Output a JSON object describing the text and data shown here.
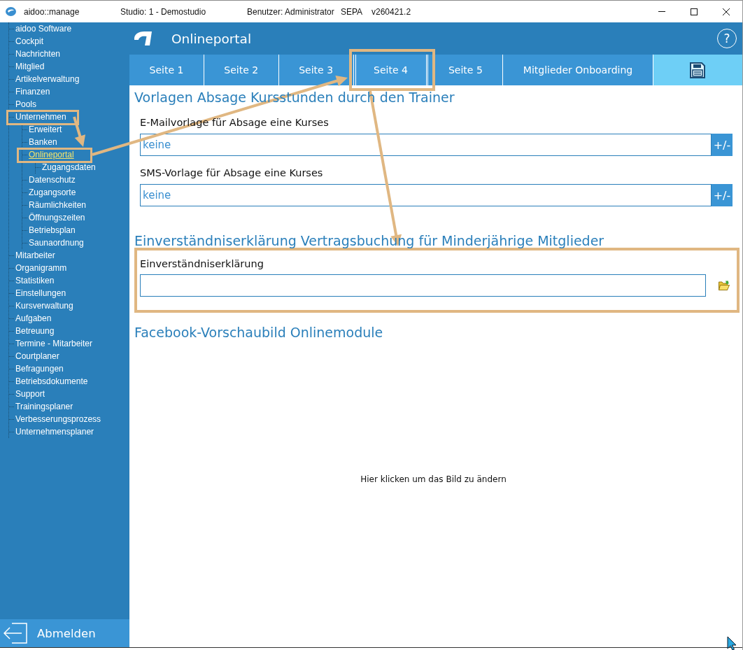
{
  "title_bar": {
    "app_name": "aidoo::manage",
    "studio": "Studio: 1 - Demostudio",
    "user": "Benutzer: Administrator",
    "sepa": "SEPA",
    "version": "v260421.2"
  },
  "sidebar": {
    "items": [
      {
        "label": "aidoo Software",
        "selected": false
      },
      {
        "label": "Cockpit",
        "selected": false
      },
      {
        "label": "Nachrichten",
        "selected": false
      },
      {
        "label": "Mitglied",
        "selected": false
      },
      {
        "label": "Artikelverwaltung",
        "selected": false
      },
      {
        "label": "Finanzen",
        "selected": false
      },
      {
        "label": "Pools",
        "selected": false
      },
      {
        "label": "Unternehmen",
        "selected": false,
        "children": [
          {
            "label": "Erweitert",
            "selected": false
          },
          {
            "label": "Banken",
            "selected": false
          },
          {
            "label": "Onlineportal",
            "selected": true,
            "children": [
              {
                "label": "Zugangsdaten",
                "selected": false
              }
            ]
          },
          {
            "label": "Datenschutz",
            "selected": false
          },
          {
            "label": "Zugangsorte",
            "selected": false
          },
          {
            "label": "Räumlichkeiten",
            "selected": false
          },
          {
            "label": "Öffnungszeiten",
            "selected": false
          },
          {
            "label": "Betriebsplan",
            "selected": false
          },
          {
            "label": "Saunaordnung",
            "selected": false
          }
        ]
      },
      {
        "label": "Mitarbeiter",
        "selected": false
      },
      {
        "label": "Organigramm",
        "selected": false
      },
      {
        "label": "Statistiken",
        "selected": false
      },
      {
        "label": "Einstellungen",
        "selected": false
      },
      {
        "label": "Kursverwaltung",
        "selected": false
      },
      {
        "label": "Aufgaben",
        "selected": false
      },
      {
        "label": "Betreuung",
        "selected": false
      },
      {
        "label": "Termine - Mitarbeiter",
        "selected": false
      },
      {
        "label": "Courtplaner",
        "selected": false
      },
      {
        "label": "Befragungen",
        "selected": false
      },
      {
        "label": "Betriebsdokumente",
        "selected": false
      },
      {
        "label": "Support",
        "selected": false
      },
      {
        "label": "Trainingsplaner",
        "selected": false
      },
      {
        "label": "Verbesserungsprozess",
        "selected": false
      },
      {
        "label": "Unternehmensplaner",
        "selected": false
      }
    ],
    "logout": "Abmelden"
  },
  "header": {
    "title": "Onlineportal",
    "help": "?"
  },
  "tabs": [
    {
      "label": "Seite 1",
      "selected": false
    },
    {
      "label": "Seite 2",
      "selected": false
    },
    {
      "label": "Seite 3",
      "selected": false
    },
    {
      "label": "Seite 4",
      "selected": true
    },
    {
      "label": "Seite 5",
      "selected": false
    },
    {
      "label": "Mitglieder Onboarding",
      "selected": false
    }
  ],
  "sections": [
    {
      "heading": "Vorlagen Absage Kursstunden durch den Trainer",
      "fields": [
        {
          "kind": "template",
          "label": "E-Mailvorlage für Absage eine Kurses",
          "value": "keine",
          "button": "+/-"
        },
        {
          "kind": "template",
          "label": "SMS-Vorlage für Absage eine Kurses",
          "value": "keine",
          "button": "+/-"
        }
      ]
    },
    {
      "heading": "Einverständniserklärung Vertragsbuchung für Minderjährige Mitglieder",
      "fields": [
        {
          "kind": "file",
          "label": "Einverständniserklärung"
        }
      ]
    },
    {
      "heading": "Facebook-Vorschaubild Onlinemodule",
      "image_hint": "Hier klicken um das Bild zu ändern"
    }
  ]
}
